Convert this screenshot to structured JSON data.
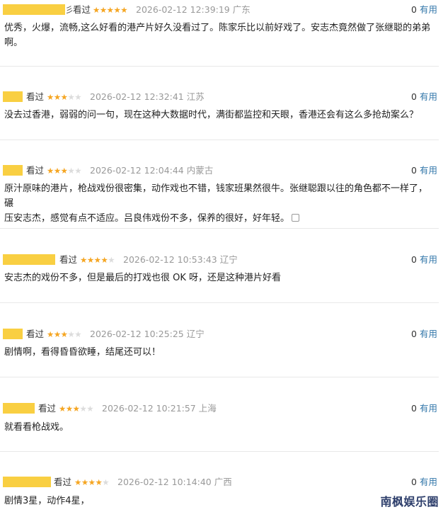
{
  "watched_label": "看过",
  "useful_label": "有用",
  "reviews": [
    {
      "name_tail": "彡",
      "stars": 5,
      "datetime": "2026-02-12 12:39:19",
      "region": "广东",
      "useful_count": "0",
      "text": "优秀，火爆，流畅,这么好看的港产片好久没看过了。陈家乐比以前好戏了。安志杰竟然做了张继聪的弟弟\n啊。"
    },
    {
      "name_tail": "",
      "stars": 3,
      "datetime": "2026-02-12 12:32:41",
      "region": "江苏",
      "useful_count": "0",
      "text": "没去过香港，弱弱的问一句，现在这种大数据时代，满街都监控和天眼，香港还会有这么多抢劫案么？"
    },
    {
      "name_tail": "",
      "stars": 3,
      "datetime": "2026-02-12 12:04:44",
      "region": "内蒙古",
      "useful_count": "0",
      "text": "原汁原味的港片，枪战戏份很密集，动作戏也不错，钱家班果然很牛。张继聪跟以往的角色都不一样了，碾\n压安志杰，感觉有点不适应。吕良伟戏份不多，保养的很好，好年轻。"
    },
    {
      "name_tail": "",
      "stars": 4,
      "datetime": "2026-02-12 10:53:43",
      "region": "辽宁",
      "useful_count": "0",
      "text": "安志杰的戏份不多，但是最后的打戏也很 OK 呀，还是这种港片好看"
    },
    {
      "name_tail": "",
      "stars": 3,
      "datetime": "2026-02-12 10:25:25",
      "region": "辽宁",
      "useful_count": "0",
      "text": "剧情啊，看得昏昏欲睡，结尾还可以！"
    },
    {
      "name_tail": "",
      "stars": 3,
      "datetime": "2026-02-12 10:21:57",
      "region": "上海",
      "useful_count": "0",
      "text": "就看看枪战戏。"
    },
    {
      "name_tail": "",
      "stars": 4,
      "datetime": "2026-02-12 10:14:40",
      "region": "广西",
      "useful_count": "0",
      "text": "剧情3星，动作4星，"
    }
  ],
  "watermark": "南枫娱乐圈",
  "colors": {
    "star_on": "#f5a623",
    "star_off": "#dcdcdc",
    "link": "#3377aa",
    "name_highlight": "#f9cf42"
  }
}
